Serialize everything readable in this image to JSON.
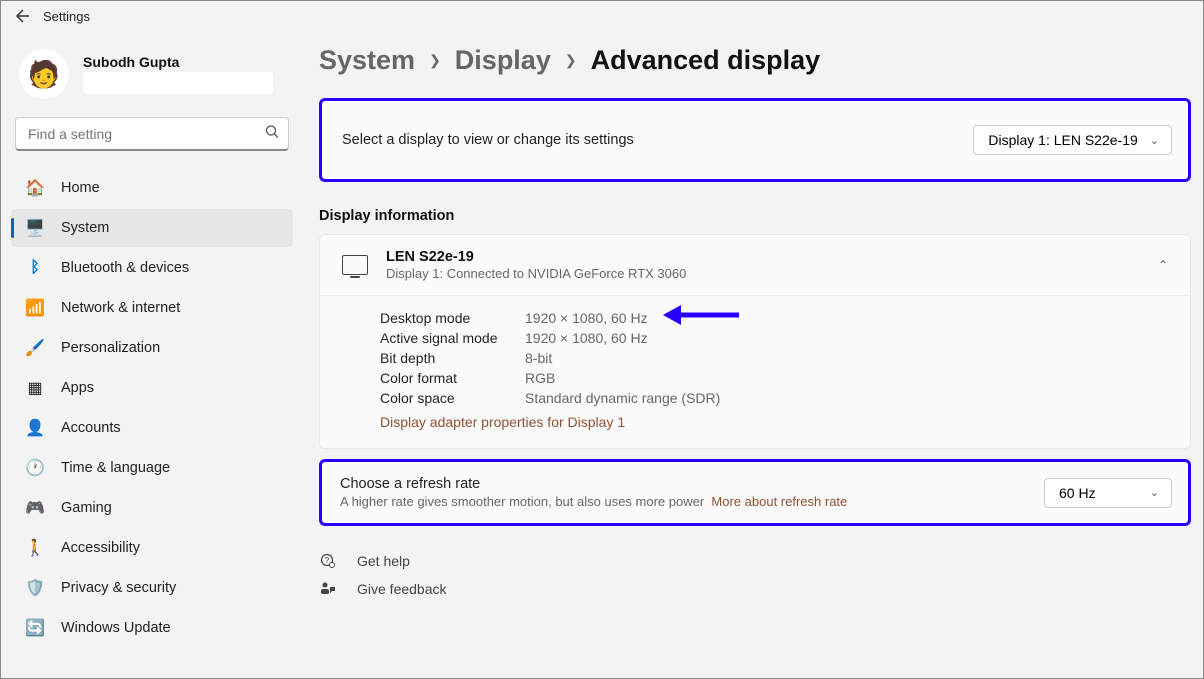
{
  "app": {
    "title": "Settings"
  },
  "user": {
    "name": "Subodh Gupta",
    "avatar_emoji": "🧑"
  },
  "search": {
    "placeholder": "Find a setting"
  },
  "nav": [
    {
      "label": "Home",
      "icon": "🏠"
    },
    {
      "label": "System",
      "icon": "🖥️",
      "active": true
    },
    {
      "label": "Bluetooth & devices",
      "icon": "ᛒ"
    },
    {
      "label": "Network & internet",
      "icon": "📶"
    },
    {
      "label": "Personalization",
      "icon": "🖌️"
    },
    {
      "label": "Apps",
      "icon": "▦"
    },
    {
      "label": "Accounts",
      "icon": "👤"
    },
    {
      "label": "Time & language",
      "icon": "🕐"
    },
    {
      "label": "Gaming",
      "icon": "🎮"
    },
    {
      "label": "Accessibility",
      "icon": "🚶"
    },
    {
      "label": "Privacy & security",
      "icon": "🛡️"
    },
    {
      "label": "Windows Update",
      "icon": "🔄"
    }
  ],
  "breadcrumb": {
    "l1": "System",
    "l2": "Display",
    "current": "Advanced display"
  },
  "selector": {
    "prompt": "Select a display to view or change its settings",
    "value": "Display 1: LEN S22e-19"
  },
  "display_info": {
    "section": "Display information",
    "title": "LEN S22e-19",
    "sub": "Display 1: Connected to NVIDIA GeForce RTX 3060",
    "rows": [
      {
        "label": "Desktop mode",
        "value": "1920 × 1080, 60 Hz"
      },
      {
        "label": "Active signal mode",
        "value": "1920 × 1080, 60 Hz"
      },
      {
        "label": "Bit depth",
        "value": "8-bit"
      },
      {
        "label": "Color format",
        "value": "RGB"
      },
      {
        "label": "Color space",
        "value": "Standard dynamic range (SDR)"
      }
    ],
    "adapter_link": "Display adapter properties for Display 1"
  },
  "refresh": {
    "title": "Choose a refresh rate",
    "sub": "A higher rate gives smoother motion, but also uses more power",
    "link": "More about refresh rate",
    "value": "60 Hz"
  },
  "footer": {
    "help": "Get help",
    "feedback": "Give feedback"
  }
}
